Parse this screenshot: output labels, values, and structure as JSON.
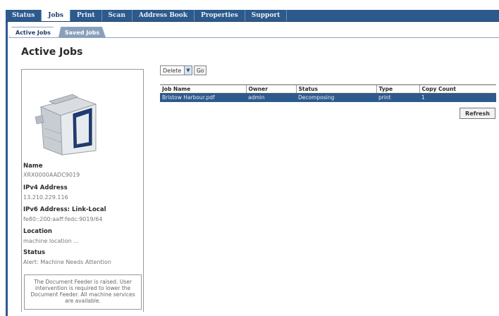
{
  "nav": {
    "items": [
      "Status",
      "Jobs",
      "Print",
      "Scan",
      "Address Book",
      "Properties",
      "Support"
    ]
  },
  "subtabs": {
    "items": [
      "Active Jobs",
      "Saved Jobs"
    ]
  },
  "page_title": "Active Jobs",
  "device": {
    "name_label": "Name",
    "name_value": "XRX0000AADC9019",
    "ipv4_label": "IPv4 Address",
    "ipv4_value": "13.210.229.116",
    "ipv6_label": "IPv6 Address: Link-Local",
    "ipv6_value": "fe80::200:aaff:fedc:9019/64",
    "location_label": "Location",
    "location_value": "machine location ...",
    "status_label": "Status",
    "status_value": "Alert: Machine Needs Attention",
    "alert_message": "The Document Feeder is raised. User intervention is required to lower the Document Feeder. All machine services are available."
  },
  "actions": {
    "select_value": "Delete",
    "go_label": "Go"
  },
  "table": {
    "headers": [
      "Job Name",
      "Owner",
      "Status",
      "Type",
      "Copy Count"
    ],
    "rows": [
      [
        "Bristow Harbour.pdf",
        "admin",
        "Decomposing",
        "print",
        "1"
      ]
    ]
  },
  "refresh_label": "Refresh"
}
